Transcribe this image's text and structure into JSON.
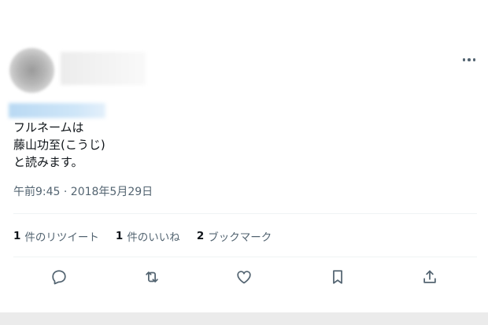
{
  "tweet": {
    "text_lines": [
      "フルネームは",
      "藤山功至(こうじ)",
      "と読みます。"
    ],
    "timestamp": "午前9:45 · 2018年5月29日"
  },
  "stats": {
    "retweets": {
      "count": "1",
      "label": "件のリツイート"
    },
    "likes": {
      "count": "1",
      "label": "件のいいね"
    },
    "bookmarks": {
      "count": "2",
      "label": "ブックマーク"
    }
  },
  "icons": {
    "more": "more-horizontal-icon",
    "reply": "reply-icon",
    "retweet": "retweet-icon",
    "like": "heart-icon",
    "bookmark": "bookmark-icon",
    "share": "share-icon"
  },
  "colors": {
    "text_primary": "#0f1419",
    "text_secondary": "#536471",
    "divider": "#eff3f4",
    "background": "#ffffff"
  }
}
